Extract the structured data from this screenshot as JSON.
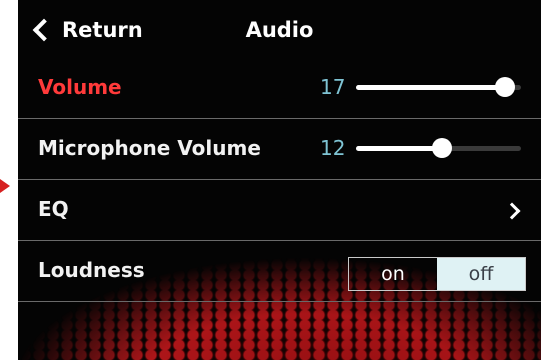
{
  "header": {
    "return_label": "Return",
    "title": "Audio"
  },
  "rows": {
    "volume": {
      "label": "Volume",
      "value": "17",
      "level": 0.9,
      "active": true
    },
    "mic": {
      "label": "Microphone Volume",
      "value": "12",
      "level": 0.52
    },
    "eq": {
      "label": "EQ"
    },
    "loudness": {
      "label": "Loudness",
      "on_label": "on",
      "off_label": "off",
      "selected": "off"
    }
  },
  "colors": {
    "active_label": "#ff3a3a",
    "value_text": "#7fc4d4",
    "selected_toggle_bg": "#dff2f4"
  },
  "icons": [
    "chevron-left-icon",
    "chevron-right-icon"
  ]
}
